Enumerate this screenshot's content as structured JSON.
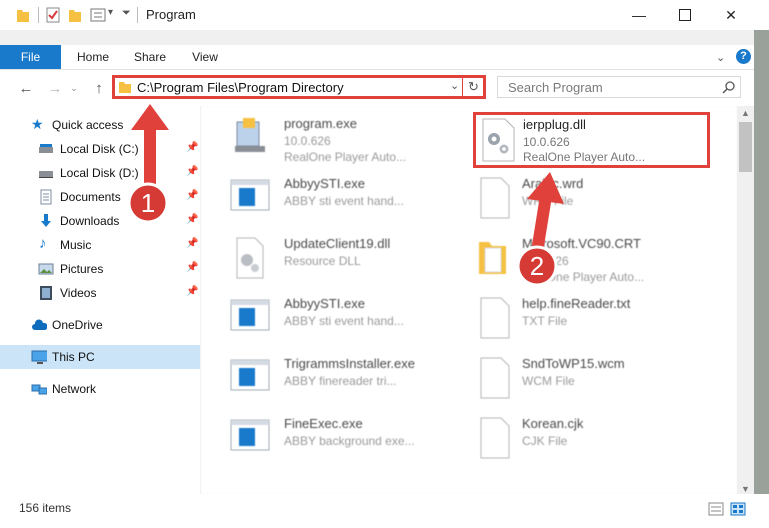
{
  "window": {
    "title": "Program",
    "minimize_icon": "minimize-icon",
    "maximize_icon": "maximize-icon",
    "close_icon": "close-icon"
  },
  "ribbon": {
    "tabs": [
      "File",
      "Home",
      "Share",
      "View"
    ],
    "help_icon": "help-icon"
  },
  "address": {
    "path": "C:\\Program Files\\Program Directory",
    "search_placeholder": "Search Program"
  },
  "nav": {
    "items": [
      {
        "label": "Quick access",
        "icon": "star-icon"
      },
      {
        "label": "Local Disk (C:)",
        "icon": "drive-icon",
        "pinned": true
      },
      {
        "label": "Local Disk (D:)",
        "icon": "drive-icon",
        "pinned": true
      },
      {
        "label": "Documents",
        "icon": "documents-icon",
        "pinned": true
      },
      {
        "label": "Downloads",
        "icon": "download-icon",
        "pinned": true
      },
      {
        "label": "Music",
        "icon": "music-icon",
        "pinned": true
      },
      {
        "label": "Pictures",
        "icon": "pictures-icon",
        "pinned": true
      },
      {
        "label": "Videos",
        "icon": "videos-icon",
        "pinned": true
      },
      {
        "label": "OneDrive",
        "icon": "cloud-icon"
      },
      {
        "label": "This PC",
        "icon": "computer-icon",
        "selected": true
      },
      {
        "label": "Network",
        "icon": "network-icon"
      }
    ]
  },
  "files": {
    "left": [
      {
        "name": "program.exe",
        "line1": "10.0.626",
        "line2": "RealOne Player Auto...",
        "icon": "exe-icon"
      },
      {
        "name": "AbbyySTI.exe",
        "line1": "ABBY sti event hand...",
        "line2": "",
        "icon": "window-icon"
      },
      {
        "name": "UpdateClient19.dll",
        "line1": "Resource DLL",
        "line2": "",
        "icon": "dll-icon"
      },
      {
        "name": "AbbyySTI.exe",
        "line1": "ABBY sti event hand...",
        "line2": "",
        "icon": "window-icon"
      },
      {
        "name": "TrigrammsInstaller.exe",
        "line1": "ABBY finereader tri...",
        "line2": "",
        "icon": "window-icon"
      },
      {
        "name": "FineExec.exe",
        "line1": "ABBY background exe...",
        "line2": "",
        "icon": "window-icon"
      }
    ],
    "right": [
      {
        "name": "ierpplug.dll",
        "line1": "10.0.626",
        "line2": "RealOne Player Auto...",
        "icon": "dll-gear-icon",
        "highlighted": true
      },
      {
        "name": "Arabic.wrd",
        "line1": "WRD File",
        "line2": "",
        "icon": "blank-file-icon"
      },
      {
        "name": "Microsoft.VC90.CRT",
        "line1": "10.0.626",
        "line2": "RealOne Player Auto...",
        "icon": "folder-icon"
      },
      {
        "name": "help.fineReader.txt",
        "line1": "TXT File",
        "line2": "",
        "icon": "blank-file-icon"
      },
      {
        "name": "SndToWP15.wcm",
        "line1": "WCM File",
        "line2": "",
        "icon": "blank-file-icon"
      },
      {
        "name": "Korean.cjk",
        "line1": "CJK File",
        "line2": "",
        "icon": "blank-file-icon"
      }
    ]
  },
  "annotations": {
    "step1": "1",
    "step2": "2"
  },
  "status": {
    "count": "156 items"
  },
  "colors": {
    "accent": "#1979ca",
    "highlight": "#e0413b"
  }
}
